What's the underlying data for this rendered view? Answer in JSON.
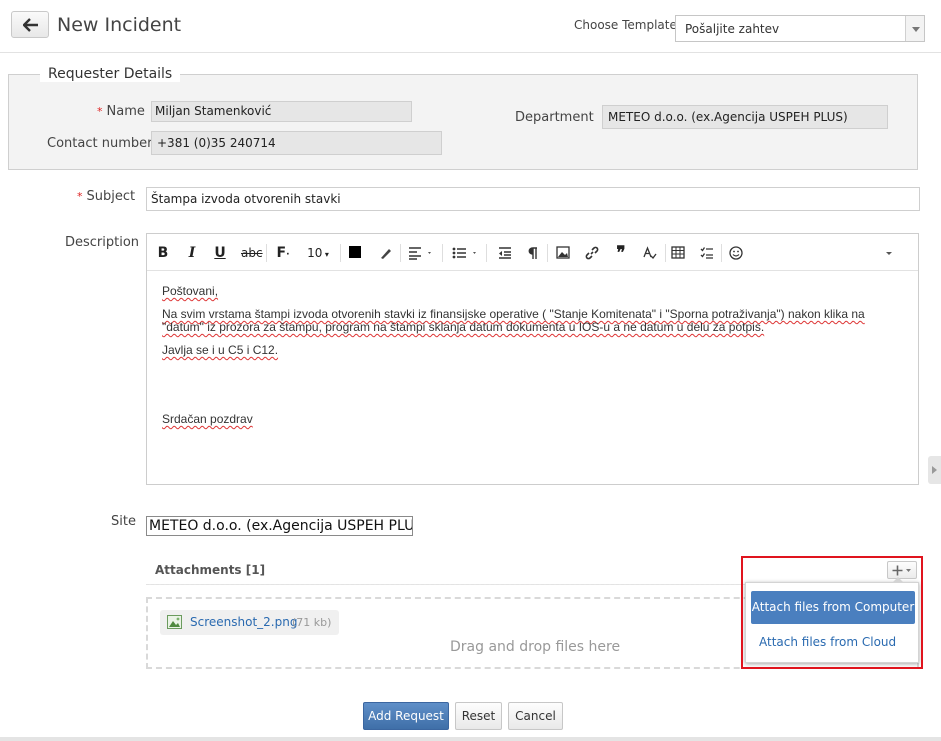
{
  "header": {
    "title": "New Incident",
    "template_label": "Choose Template",
    "template_value": "Pošaljite zahtev"
  },
  "requester": {
    "legend": "Requester Details",
    "name_label": "Name",
    "name_value": "Miljan Stamenković",
    "contact_label": "Contact number",
    "contact_value": "+381 (0)35 240714",
    "department_label": "Department",
    "department_value": "METEO d.o.o. (ex.Agencija USPEH PLUS)"
  },
  "subject": {
    "label": "Subject",
    "value": "Štampa izvoda otvorenih stavki"
  },
  "description": {
    "label": "Description",
    "toolbar": {
      "font_size": "10"
    },
    "paragraphs": [
      "Poštovani,",
      "Na svim vrstama štampi izvoda otvorenih stavki iz finansijske operative ( \"Stanje Komitenata\" i \"Sporna potraživanja\") nakon klika na \"datum\" iz prozora za štampu, program na štampi sklanja datum dokumenta u IOS-u a ne datum u delu za potpis.",
      "Javlja se i u C5 i C12.",
      "Srdačan pozdrav"
    ]
  },
  "site": {
    "label": "Site",
    "value": "METEO d.o.o. (ex.Agencija USPEH PLUS"
  },
  "attachments": {
    "heading": "Attachments [1]",
    "drop_text": "Drag and drop files here",
    "file_name": "Screenshot_2.png",
    "file_size": "(71 kb)",
    "menu": {
      "from_computer": "Attach files from Computer",
      "from_cloud": "Attach files from Cloud"
    }
  },
  "actions": {
    "add": "Add Request",
    "reset": "Reset",
    "cancel": "Cancel"
  },
  "colors": {
    "primary": "#4a7fbf",
    "highlight": "#e0141e",
    "required": "#d22222"
  }
}
